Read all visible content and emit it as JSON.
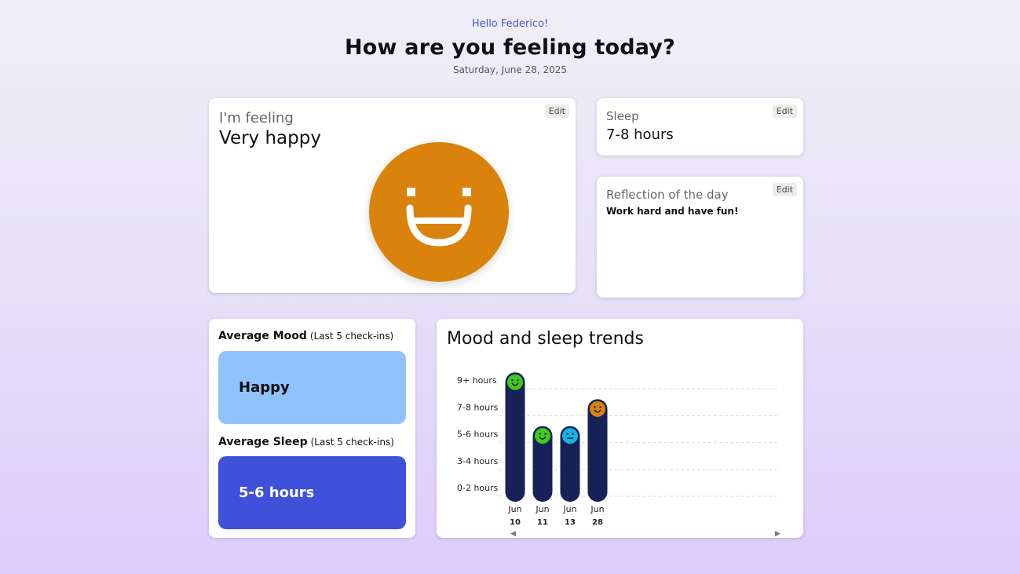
{
  "header": {
    "greeting": "Hello Federico!",
    "title": "How are you feeling today?",
    "date": "Saturday, June 28, 2025"
  },
  "feeling": {
    "label": "I'm feeling",
    "value": "Very happy",
    "edit_label": "Edit",
    "face_color": "#d9830d"
  },
  "sleep": {
    "label": "Sleep",
    "value": "7-8 hours",
    "edit_label": "Edit"
  },
  "reflection": {
    "label": "Reflection of the day",
    "text": "Work hard and have fun!",
    "edit_label": "Edit"
  },
  "averages": {
    "mood_title": "Average Mood",
    "mood_sub": "(Last 5 check-ins)",
    "mood_value": "Happy",
    "sleep_title": "Average Sleep",
    "sleep_sub": "(Last 5 check-ins)",
    "sleep_value": "5-6 hours"
  },
  "trends": {
    "title": "Mood and sleep trends",
    "scroll_left_icon": "triangle-left",
    "scroll_right_icon": "triangle-right"
  },
  "chart_data": {
    "type": "bar",
    "y_categories": [
      "0-2 hours",
      "3-4 hours",
      "5-6 hours",
      "7-8 hours",
      "9+ hours"
    ],
    "bars": [
      {
        "month": "Jun",
        "day": "10",
        "sleep": "9+ hours",
        "mood": "happy",
        "mood_color": "#3fcb1c"
      },
      {
        "month": "Jun",
        "day": "11",
        "sleep": "5-6 hours",
        "mood": "happy",
        "mood_color": "#3fcb1c"
      },
      {
        "month": "Jun",
        "day": "13",
        "sleep": "5-6 hours",
        "mood": "neutral",
        "mood_color": "#14b3e8"
      },
      {
        "month": "Jun",
        "day": "28",
        "sleep": "7-8 hours",
        "mood": "very happy",
        "mood_color": "#d9830d"
      }
    ],
    "bar_color": "#162257",
    "grid": true
  }
}
